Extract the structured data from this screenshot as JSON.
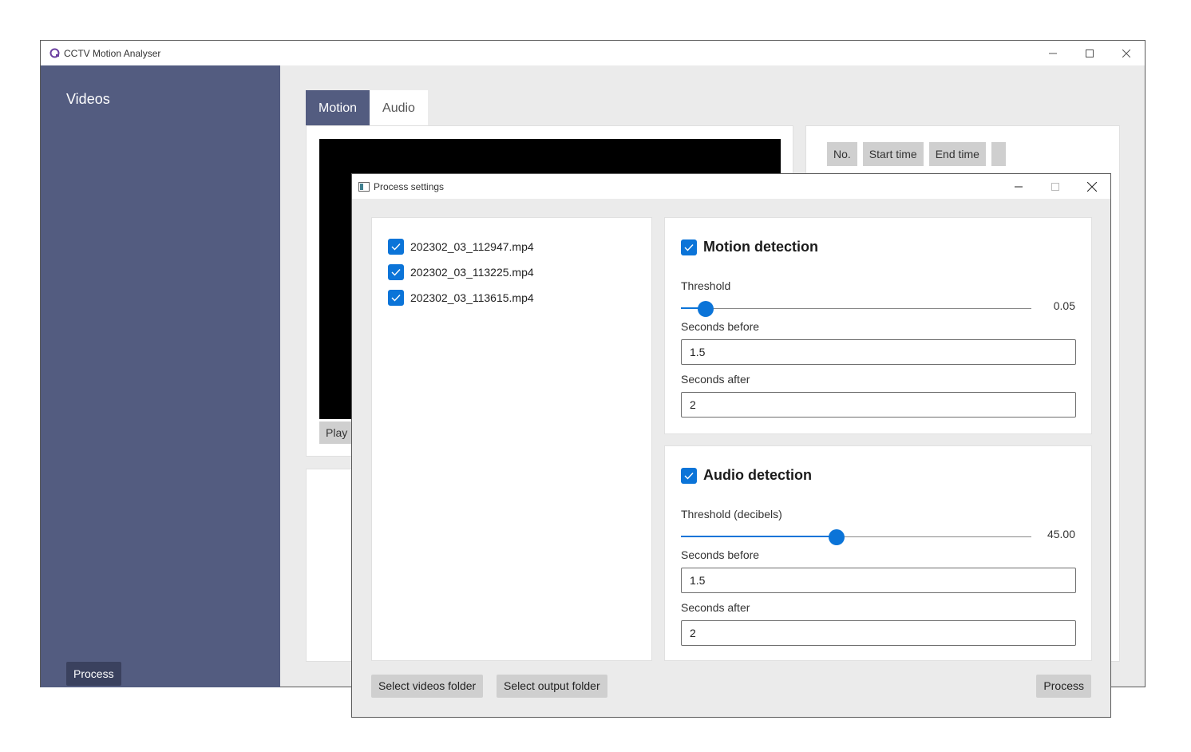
{
  "main_window": {
    "title": "CCTV Motion Analyser",
    "sidebar": {
      "heading": "Videos",
      "process_label": "Process"
    },
    "tabs": [
      {
        "label": "Motion",
        "active": true
      },
      {
        "label": "Audio",
        "active": false
      }
    ],
    "video": {
      "play_label": "Play"
    },
    "table": {
      "columns": [
        "No.",
        "Start time",
        "End time",
        ""
      ]
    }
  },
  "dialog": {
    "title": "Process settings",
    "files": [
      {
        "name": "202302_03_112947.mp4",
        "checked": true
      },
      {
        "name": "202302_03_113225.mp4",
        "checked": true
      },
      {
        "name": "202302_03_113615.mp4",
        "checked": true
      }
    ],
    "motion": {
      "label": "Motion detection",
      "checked": true,
      "threshold_label": "Threshold",
      "threshold_value": "0.05",
      "threshold_fraction": 0.07,
      "seconds_before_label": "Seconds before",
      "seconds_before": "1.5",
      "seconds_after_label": "Seconds after",
      "seconds_after": "2"
    },
    "audio": {
      "label": "Audio detection",
      "checked": true,
      "threshold_label": "Threshold (decibels)",
      "threshold_value": "45.00",
      "threshold_fraction": 0.445,
      "seconds_before_label": "Seconds before",
      "seconds_before": "1.5",
      "seconds_after_label": "Seconds after",
      "seconds_after": "2"
    },
    "buttons": {
      "select_videos": "Select videos folder",
      "select_output": "Select output folder",
      "process": "Process"
    }
  },
  "colors": {
    "sidebar": "#535c80",
    "accent": "#0b74d8"
  }
}
